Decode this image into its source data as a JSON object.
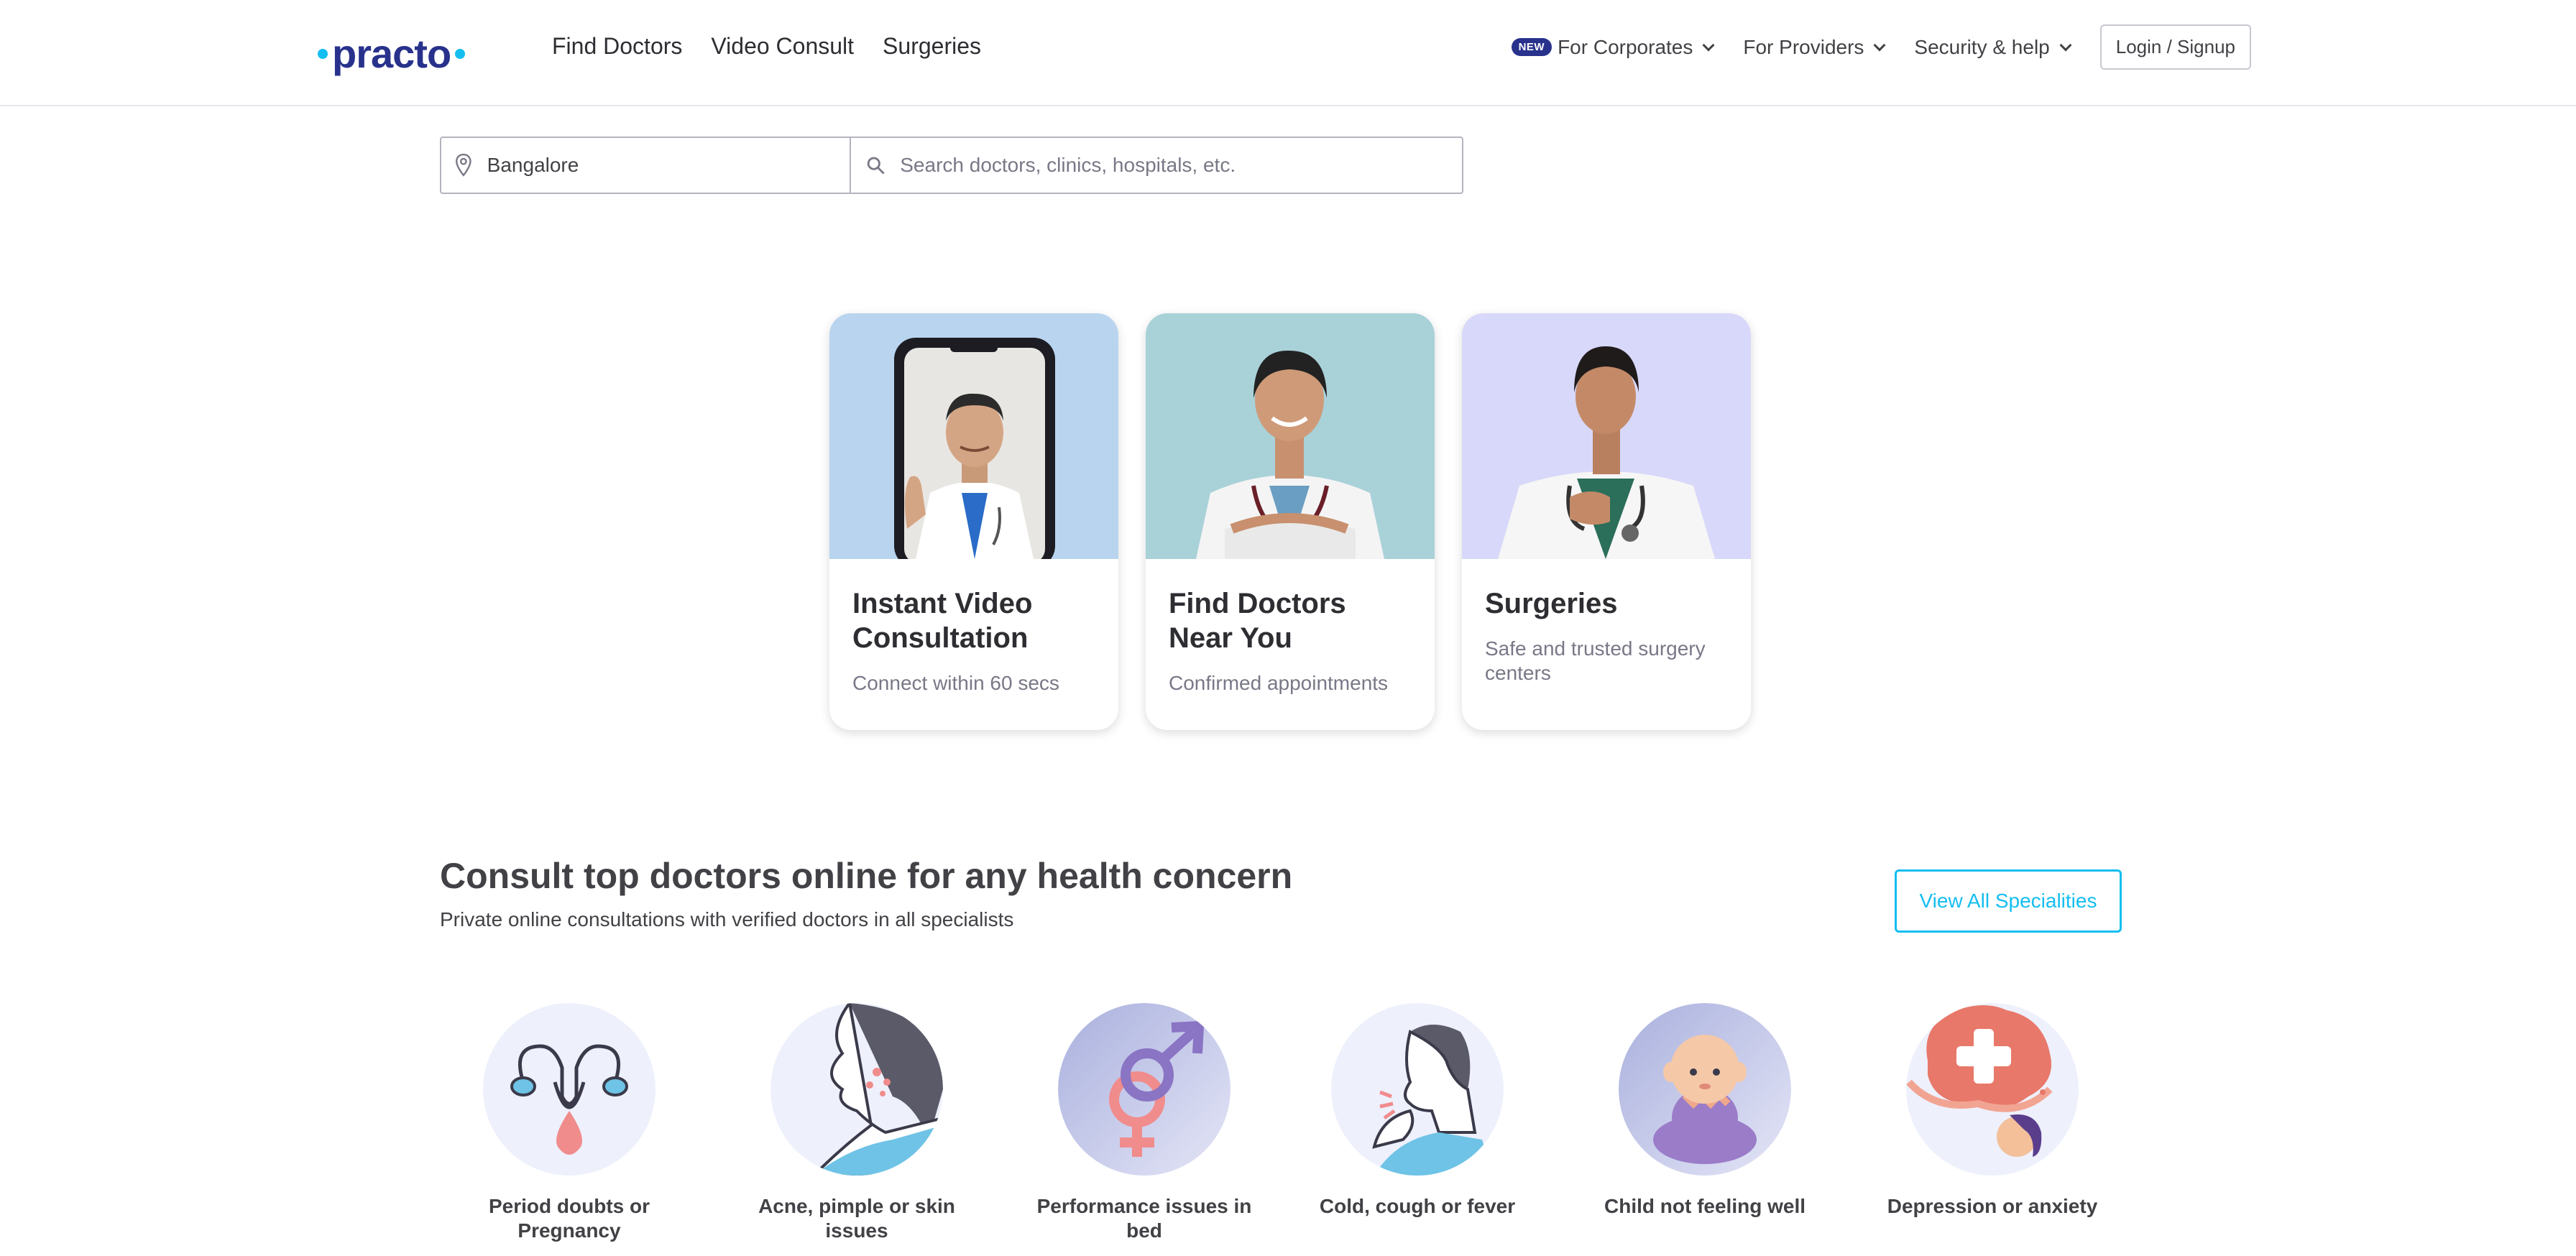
{
  "header": {
    "logo_text": "practo",
    "nav": [
      "Find Doctors",
      "Video Consult",
      "Surgeries"
    ],
    "new_badge": "NEW",
    "corporates": "For Corporates",
    "providers": "For Providers",
    "security": "Security & help",
    "login": "Login / Signup"
  },
  "search": {
    "location_value": "Bangalore",
    "query_placeholder": "Search doctors, clinics, hospitals, etc."
  },
  "cards": [
    {
      "title": "Instant Video Consultation",
      "subtitle": "Connect within 60 secs",
      "bg": "#b9d4ee"
    },
    {
      "title": "Find Doctors Near You",
      "subtitle": "Confirmed appointments",
      "bg": "#a9d1d8"
    },
    {
      "title": "Surgeries",
      "subtitle": "Safe and trusted surgery centers",
      "bg": "#d8d8fa"
    }
  ],
  "specialities": {
    "title": "Consult top doctors online for any health concern",
    "subtitle": "Private online consultations with verified doctors in all specialists",
    "view_all": "View All Specialities",
    "items": [
      {
        "label": "Period doubts or Pregnancy",
        "icon": "uterus-icon"
      },
      {
        "label": "Acne, pimple or skin issues",
        "icon": "skin-icon"
      },
      {
        "label": "Performance issues in bed",
        "icon": "gender-icon"
      },
      {
        "label": "Cold, cough or fever",
        "icon": "cough-icon"
      },
      {
        "label": "Child not feeling well",
        "icon": "baby-icon"
      },
      {
        "label": "Depression or anxiety",
        "icon": "mental-health-icon"
      }
    ]
  },
  "colors": {
    "brand": "#28328c",
    "accent": "#14bef0"
  }
}
